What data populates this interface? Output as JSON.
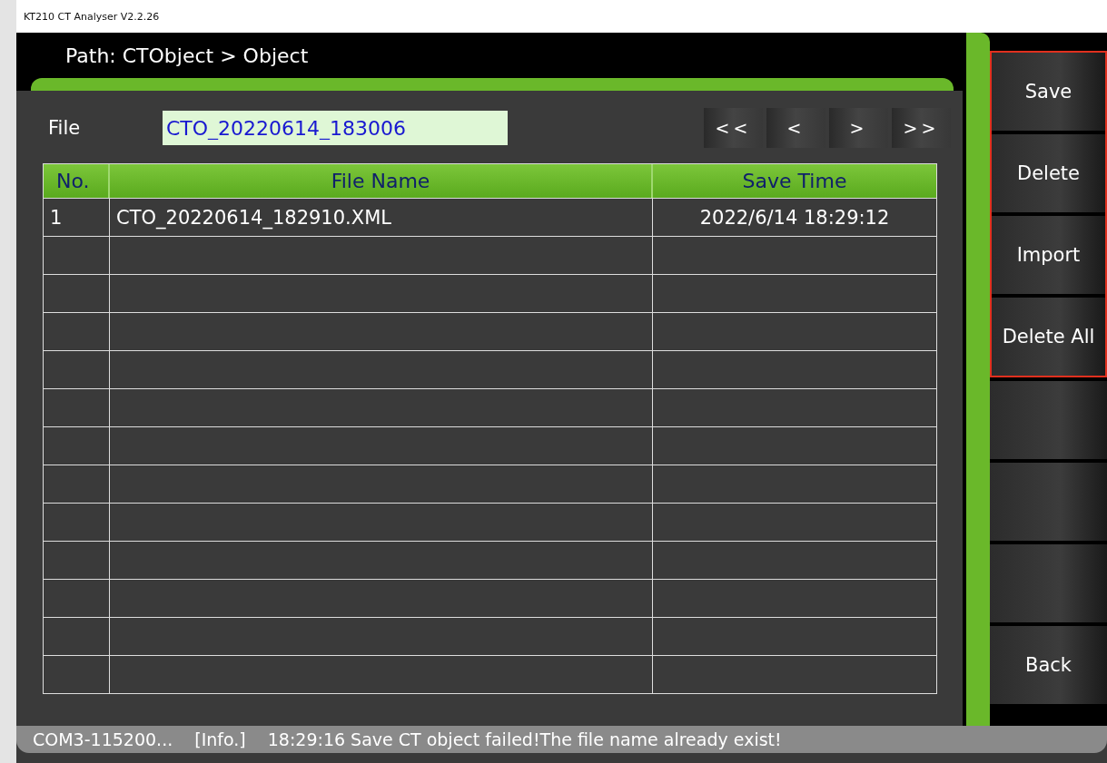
{
  "window": {
    "title": "KT210 CT Analyser V2.2.26"
  },
  "path": "Path:  CTObject > Object",
  "file_field": {
    "label": "File",
    "value": "CTO_20220614_183006"
  },
  "pager": [
    "<<",
    "<",
    ">",
    ">>"
  ],
  "table": {
    "columns": [
      "No.",
      "File Name",
      "Save Time"
    ],
    "rows": [
      {
        "no": "1",
        "file_name": "CTO_20220614_182910.XML",
        "save_time": "2022/6/14 18:29:12"
      }
    ]
  },
  "sidebar": [
    {
      "kind": "action",
      "label": "Save",
      "highlighted": true
    },
    {
      "kind": "action",
      "label": "Delete",
      "highlighted": true
    },
    {
      "kind": "action",
      "label": "Import",
      "highlighted": true
    },
    {
      "kind": "action",
      "label": "Delete All",
      "highlighted": true
    },
    {
      "kind": "blank",
      "highlighted": false
    },
    {
      "kind": "blank",
      "highlighted": false
    },
    {
      "kind": "blank",
      "highlighted": false
    },
    {
      "kind": "action",
      "label": "Back",
      "highlighted": false
    }
  ],
  "status_bar": {
    "port": "COM3-115200...",
    "level": "[Info.]",
    "message": "18:29:16 Save CT object failed!The file name already exist!"
  }
}
